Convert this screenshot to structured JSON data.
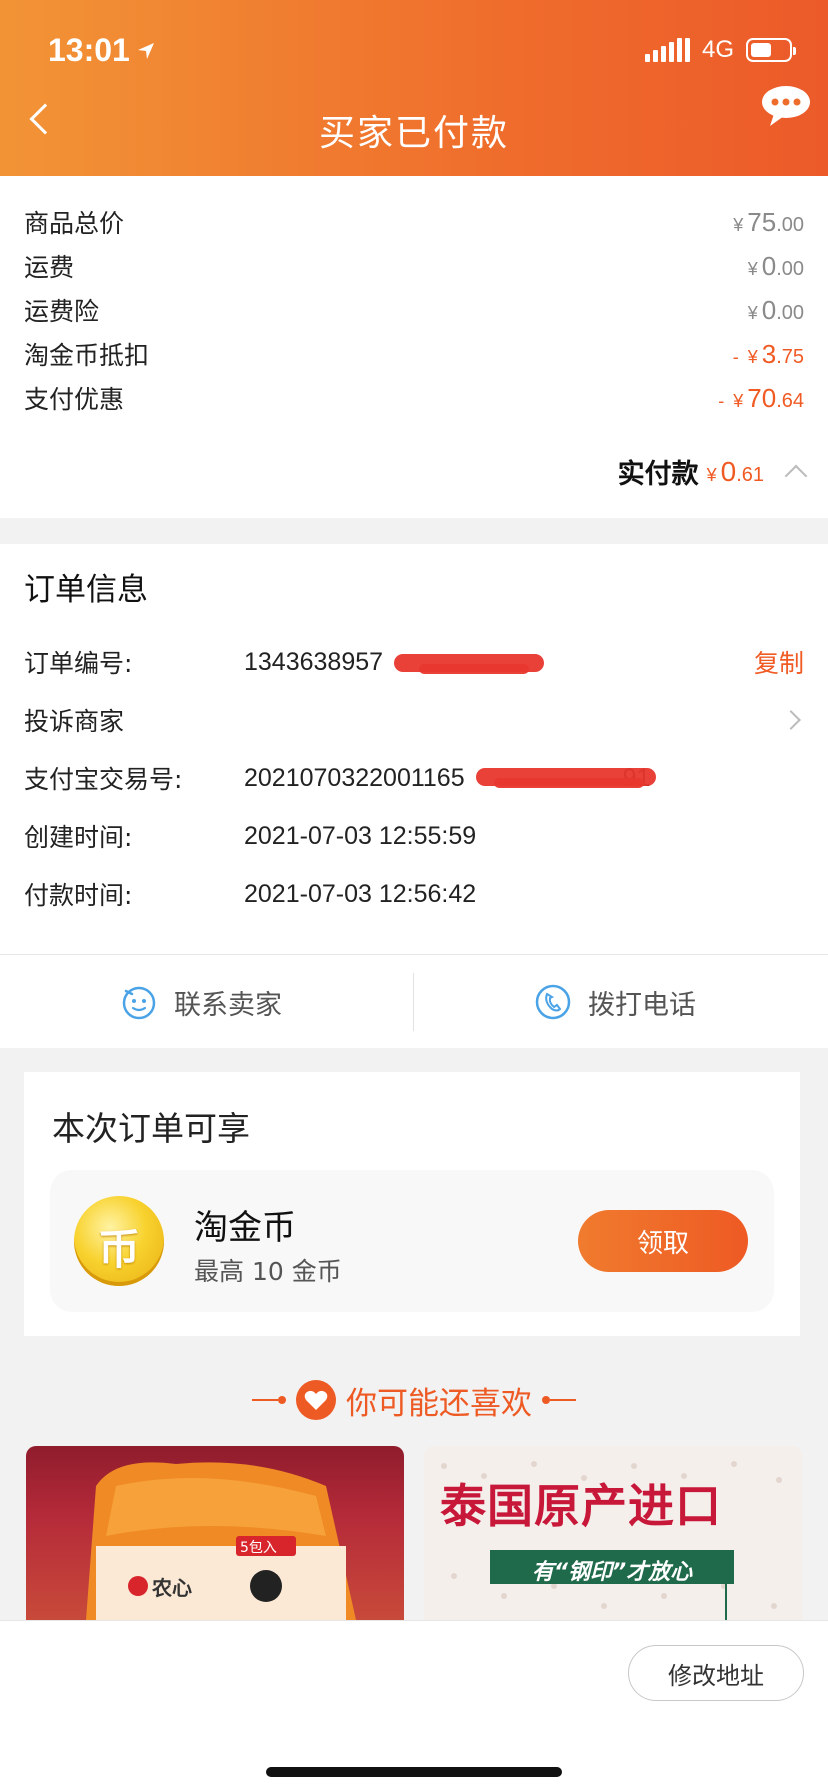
{
  "status_bar": {
    "time": "13:01",
    "network": "4G"
  },
  "header": {
    "title": "买家已付款"
  },
  "price": {
    "rows": [
      {
        "label": "商品总价",
        "sign": "",
        "yen": "¥",
        "int": "75",
        "dec": ".00"
      },
      {
        "label": "运费",
        "sign": "",
        "yen": "¥",
        "int": "0",
        "dec": ".00"
      },
      {
        "label": "运费险",
        "sign": "",
        "yen": "¥",
        "int": "0",
        "dec": ".00"
      },
      {
        "label": "淘金币抵扣",
        "sign": "- ",
        "yen": "¥",
        "int": "3",
        "dec": ".75"
      },
      {
        "label": "支付优惠",
        "sign": "- ",
        "yen": "¥",
        "int": "70",
        "dec": ".64"
      }
    ],
    "actual_label": "实付款",
    "actual_yen": "¥",
    "actual_int": "0",
    "actual_dec": ".61"
  },
  "order": {
    "title": "订单信息",
    "order_no_label": "订单编号:",
    "order_no": "1343638957",
    "copy_label": "复制",
    "complain_label": "投诉商家",
    "alipay_label": "支付宝交易号:",
    "alipay_no": "2021070322001165",
    "alipay_tail": "91",
    "created_label": "创建时间:",
    "created_time": "2021-07-03 12:55:59",
    "paid_label": "付款时间:",
    "paid_time": "2021-07-03 12:56:42"
  },
  "contact": {
    "seller_label": "联系卖家",
    "phone_label": "拨打电话"
  },
  "benefit": {
    "title": "本次订单可享",
    "coin_symbol": "币",
    "coin_name": "淘金币",
    "coin_sub": "最高 10 金币",
    "claim_label": "领取"
  },
  "recommend": {
    "title": "你可能还喜欢",
    "product1": {
      "brand": "农心",
      "tag": "5包入"
    },
    "product2": {
      "headline": "泰国原产进口",
      "banner": "有“钢印”才放心"
    }
  },
  "bottom": {
    "modify_address_label": "修改地址"
  },
  "colors": {
    "accent": "#f05a23",
    "header_start": "#f29436",
    "header_end": "#ec5a2a"
  }
}
